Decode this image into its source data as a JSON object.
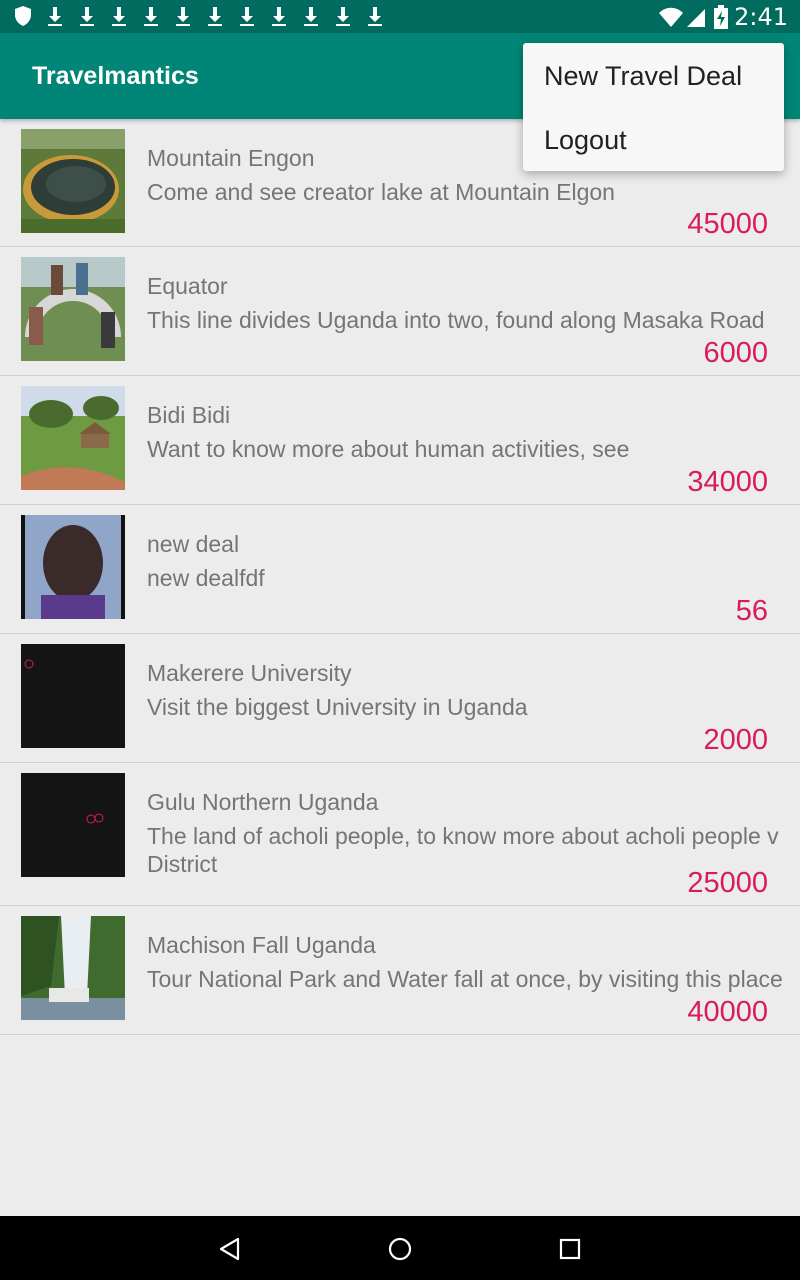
{
  "status_bar": {
    "time": "2:41",
    "left_icons": [
      "shield-icon",
      "download-icon",
      "download-icon",
      "download-icon",
      "download-icon",
      "download-icon",
      "download-icon",
      "download-icon",
      "download-icon",
      "download-icon",
      "download-icon",
      "download-icon"
    ],
    "right_icons": [
      "wifi-icon",
      "cell-signal-icon",
      "battery-charging-icon"
    ]
  },
  "app_bar": {
    "title": "Travelmantics"
  },
  "overflow_menu": {
    "items": [
      {
        "label": "New Travel Deal"
      },
      {
        "label": "Logout"
      }
    ]
  },
  "deals": [
    {
      "name": "Mountain Engon",
      "description": "Come and see creator lake at Mountain Elgon",
      "price": "45000",
      "image": "crater-lake-photo"
    },
    {
      "name": "Equator",
      "description": "This line divides Uganda into two, found along Masaka Road",
      "price": "6000",
      "image": "equator-monument-photo"
    },
    {
      "name": "Bidi Bidi",
      "description": "Want to know more about human activities, see",
      "price": "34000",
      "image": "village-huts-photo"
    },
    {
      "name": "new deal",
      "description": "new dealfdf",
      "price": "56",
      "image": "portrait-photo"
    },
    {
      "name": "Makerere University",
      "description": "Visit the biggest University in Uganda",
      "price": "2000",
      "image": "dark-image"
    },
    {
      "name": "Gulu Northern Uganda",
      "description": "The land of acholi people, to know more about acholi people v",
      "description_line2": "District",
      "price": "25000",
      "image": "dark-image"
    },
    {
      "name": "Machison Fall Uganda",
      "description": "Tour National Park and Water fall at once, by visiting this place",
      "price": "40000",
      "image": "waterfall-photo"
    }
  ],
  "nav_bar": {
    "icons": [
      "back-icon",
      "home-icon",
      "recents-icon"
    ]
  },
  "colors": {
    "primary": "#008577",
    "primary_dark": "#006b5e",
    "accent": "#d81b60",
    "background": "#ececec"
  }
}
